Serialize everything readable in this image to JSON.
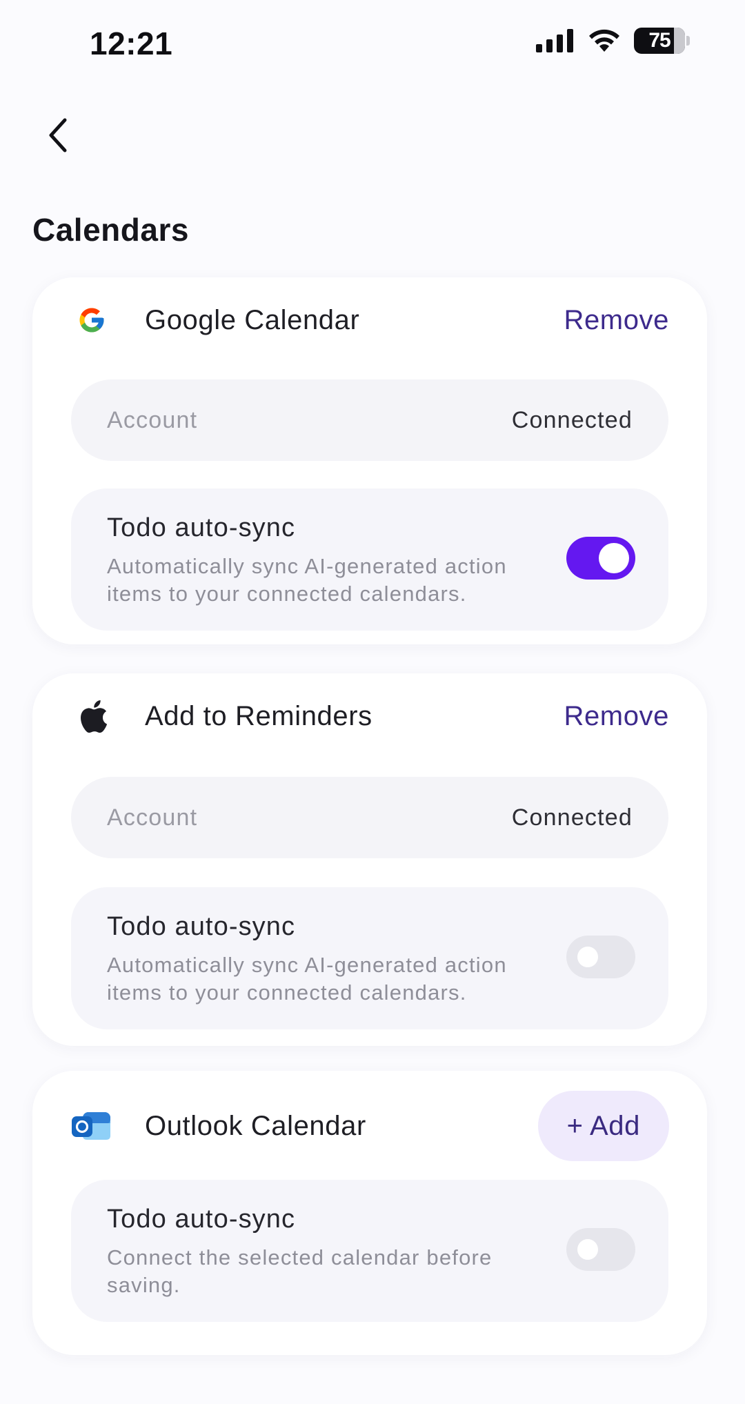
{
  "status_bar": {
    "time": "12:21",
    "battery": "75"
  },
  "page": {
    "title": "Calendars"
  },
  "colors": {
    "accent": "#6418F0",
    "link": "#3D2A8C",
    "add_bg": "#EFEAFC"
  },
  "cards": [
    {
      "name": "Google Calendar",
      "icon": "google-logo-icon",
      "action_label": "Remove",
      "account_label": "Account",
      "account_status": "Connected",
      "sync_title": "Todo auto-sync",
      "sync_desc": "Automatically sync AI-generated action items to your connected calendars.",
      "sync_enabled": true
    },
    {
      "name": "Add to Reminders",
      "icon": "apple-logo-icon",
      "action_label": "Remove",
      "account_label": "Account",
      "account_status": "Connected",
      "sync_title": "Todo auto-sync",
      "sync_desc": "Automatically sync AI-generated action items to your connected calendars.",
      "sync_enabled": false
    },
    {
      "name": "Outlook Calendar",
      "icon": "outlook-logo-icon",
      "action_label": "+ Add",
      "sync_title": "Todo auto-sync",
      "sync_desc": "Connect the selected calendar before saving.",
      "sync_enabled": false
    }
  ]
}
